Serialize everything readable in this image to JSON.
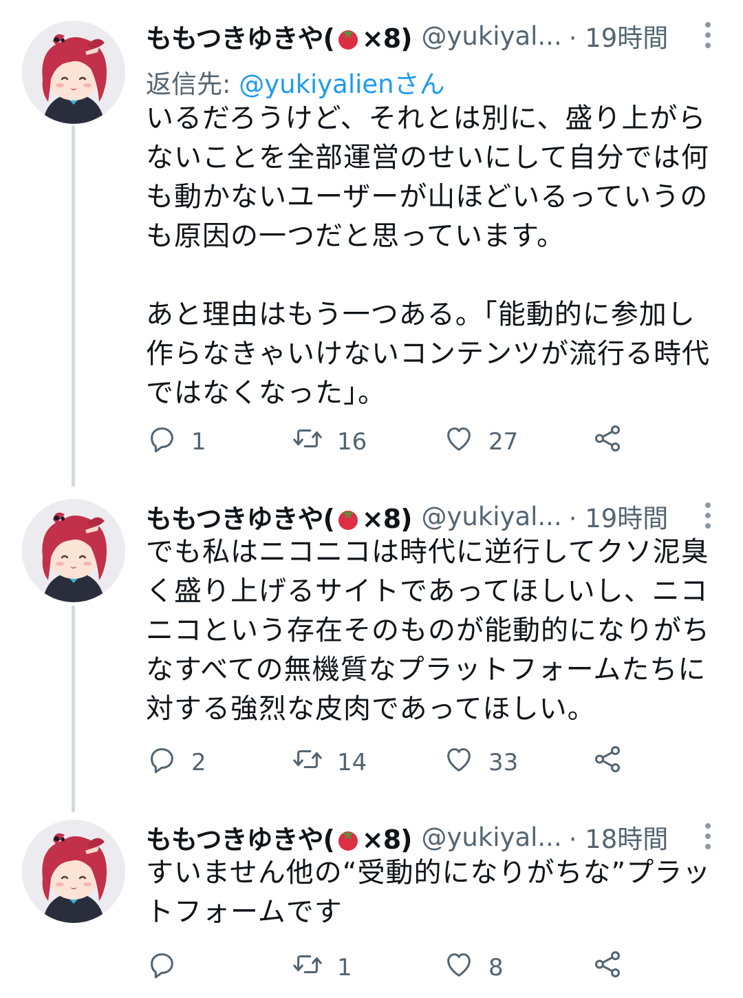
{
  "tweets": [
    {
      "name": "ももつきゆきや(",
      "emoji": "tomato-emoji",
      "name_suffix": "×8)",
      "handle": "@yukiyal...",
      "time": "· 19時間",
      "reply_prefix": "返信先: ",
      "reply_mention": "@yukiyalien",
      "reply_suffix": "さん",
      "text": "いるだろうけど、それとは別に、盛り上がら\nないことを全部運営のせいにして自分では何\nも動かないユーザーが山ほどいるっていうの\nも原因の一つだと思っています。\n\nあと理由はもう一つある。「能動的に参加し\n作らなきゃいけないコンテンツが流行る時代\nではなくなった」。",
      "replies": "1",
      "retweets": "16",
      "likes": "27"
    },
    {
      "name": "ももつきゆきや(",
      "emoji": "tomato-emoji",
      "name_suffix": "×8)",
      "handle": "@yukiyal...",
      "time": "· 19時間",
      "text": "でも私はニコニコは時代に逆行してクソ泥臭\nく盛り上げるサイトであってほしいし、ニコ\nニコという存在そのものが能動的になりがち\nなすべての無機質なプラットフォームたちに\n対する強烈な皮肉であってほしい。",
      "replies": "2",
      "retweets": "14",
      "likes": "33"
    },
    {
      "name": "ももつきゆきや(",
      "emoji": "tomato-emoji",
      "name_suffix": "×8)",
      "handle": "@yukiyal...",
      "time": "· 18時間",
      "text": "すいません他の“受動的になりがちな”プラッ\nトフォームです",
      "replies": "",
      "retweets": "1",
      "likes": "8"
    }
  ],
  "icons": {
    "reply": "reply-icon",
    "retweet": "retweet-icon",
    "like": "heart-icon",
    "share": "share-icon",
    "more": "more-options-icon"
  },
  "colors": {
    "text": "#0f1419",
    "secondary": "#536471",
    "link": "#1d9bf0",
    "thread_line": "#cfd9de"
  }
}
